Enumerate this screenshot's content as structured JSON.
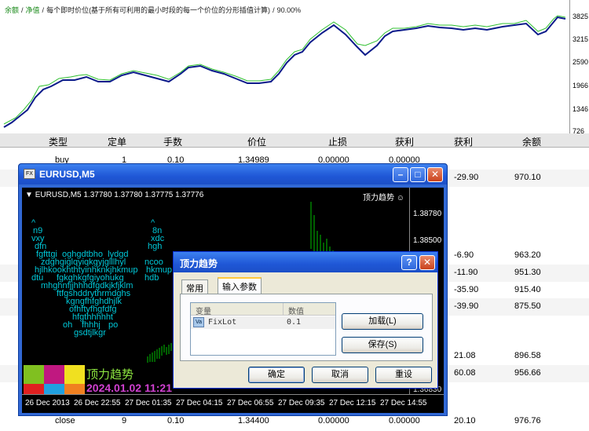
{
  "equity_chart": {
    "title_parts": [
      "余额",
      "/",
      "净值",
      "/",
      "每个即时价位(基于所有可利用的最小时段的每一个价位的分形插值计算)",
      "/",
      "90.00%"
    ],
    "axis_ticks": [
      "3825",
      "3215",
      "2590",
      "1966",
      "1346",
      "726"
    ]
  },
  "report": {
    "columns": [
      "类型",
      "定单",
      "手数",
      "价位",
      "止损",
      "获利",
      "获利",
      "余额"
    ],
    "rows": [
      [
        "buy",
        "1",
        "0.10",
        "1.34989",
        "0.00000",
        "0.00000",
        "",
        ""
      ],
      [
        "",
        "",
        "",
        "",
        "",
        "",
        "-29.90",
        "970.10"
      ],
      [
        "",
        "",
        "",
        "",
        "",
        "",
        "-6.90",
        "963.20"
      ],
      [
        "",
        "",
        "",
        "",
        "",
        "",
        "-11.90",
        "951.30"
      ],
      [
        "",
        "",
        "",
        "",
        "",
        "",
        "-35.90",
        "915.40"
      ],
      [
        "",
        "",
        "",
        "",
        "",
        "",
        "-39.90",
        "875.50"
      ],
      [
        "",
        "",
        "",
        "",
        "",
        "",
        "21.08",
        "896.58"
      ],
      [
        "",
        "",
        "",
        "",
        "",
        "",
        "60.08",
        "956.66"
      ],
      [
        "close",
        "9",
        "0.10",
        "1.34400",
        "0.00000",
        "0.00000",
        "20.10",
        "976.76"
      ]
    ]
  },
  "chart_window": {
    "title": "EURUSD,M5",
    "header_info": "EURUSD,M5  1.37780 1.37780 1.37775 1.37776",
    "indicator_label": "顶力趋势",
    "price_ticks": [
      "1.38780",
      "1.38500",
      "1.36830"
    ],
    "time_ticks": [
      "26 Dec 2013",
      "26 Dec 22:55",
      "27 Dec 01:35",
      "27 Dec 04:15",
      "27 Dec 06:55",
      "27 Dec 09:35",
      "27 Dec 12:15",
      "27 Dec 14:55"
    ],
    "ascii_art": [
      "n9",
      "vxy",
      "dfn",
      "fgfttgi",
      "zdghgiglqyiqkgyjglllhyl",
      "hjlhkookhthtyinhknkjhkmup",
      "dtu",
      "fgkghkgfgiyohukg",
      "hdb",
      "mhghnfjjhhhdfgdkjkfjklm",
      "ftfgshddrythrmdghs",
      "kgngfhfghdhjlk",
      "ofhftyfhgfdfg",
      "hfgthhhhht",
      "oh",
      "fhhhj",
      "po",
      "gsdtjlkgr",
      "8n",
      "xdc",
      "hgh",
      "lydgd",
      "ncoo",
      "hkmup"
    ],
    "logo_text": "顶力趋势",
    "date_text": "2024.01.02 11:21",
    "colors": {
      "bull": "#00c000",
      "bear": "#00c000",
      "ascii": "#00c8d8"
    }
  },
  "dialog": {
    "title": "顶力趋势",
    "tabs": [
      "常用",
      "输入参数"
    ],
    "active_tab": "输入参数",
    "grid_headers": [
      "变量",
      "数值"
    ],
    "params": [
      {
        "name": "FixLot",
        "value": "0.1"
      }
    ],
    "side_buttons": [
      "加载(L)",
      "保存(S)"
    ],
    "bottom_buttons": [
      "确定",
      "取消",
      "重设"
    ]
  }
}
